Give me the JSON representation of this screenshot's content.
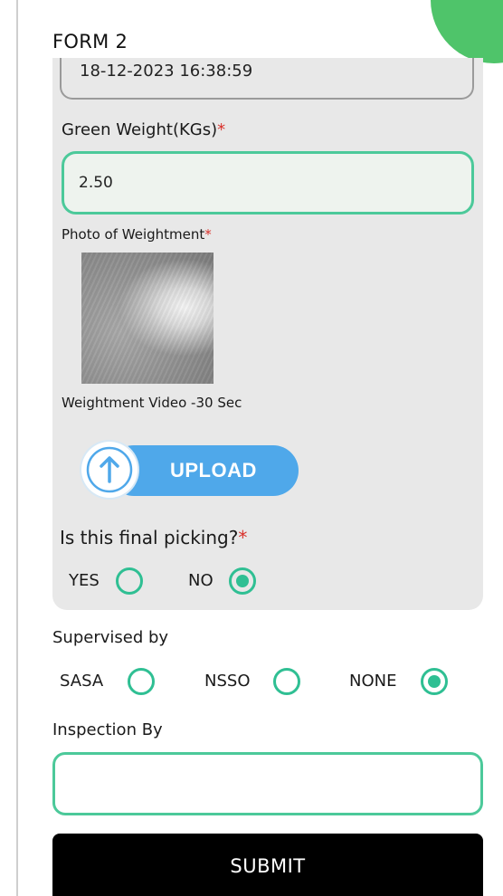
{
  "form": {
    "title": "FORM 2",
    "datetime_value": "18-12-2023 16:38:59",
    "green_weight": {
      "label": "Green Weight(KGs)",
      "required_mark": "*",
      "value": "2.50"
    },
    "photo": {
      "label": "Photo of Weightment",
      "required_mark": "*"
    },
    "video": {
      "label": "Weightment Video -30 Sec",
      "upload_label": "UPLOAD",
      "icon": "arrow-up-icon"
    },
    "final_picking": {
      "question": "Is this final picking?",
      "required_mark": "*",
      "options": [
        {
          "label": "YES",
          "checked": false
        },
        {
          "label": "NO",
          "checked": true
        }
      ]
    },
    "supervised_by": {
      "label": "Supervised by",
      "options": [
        {
          "label": "SASA",
          "checked": false
        },
        {
          "label": "NSSO",
          "checked": false
        },
        {
          "label": "NONE",
          "checked": true
        }
      ]
    },
    "inspection_by": {
      "label": "Inspection By",
      "value": ""
    },
    "submit_label": "SUBMIT"
  },
  "colors": {
    "accent_green": "#4cc99a",
    "radio_green": "#2fbf93",
    "upload_blue": "#4fa8ea",
    "corner_green": "#4fc46a",
    "required_red": "#d9312b",
    "card_gray": "#e8e8e8",
    "submit_black": "#000000"
  }
}
